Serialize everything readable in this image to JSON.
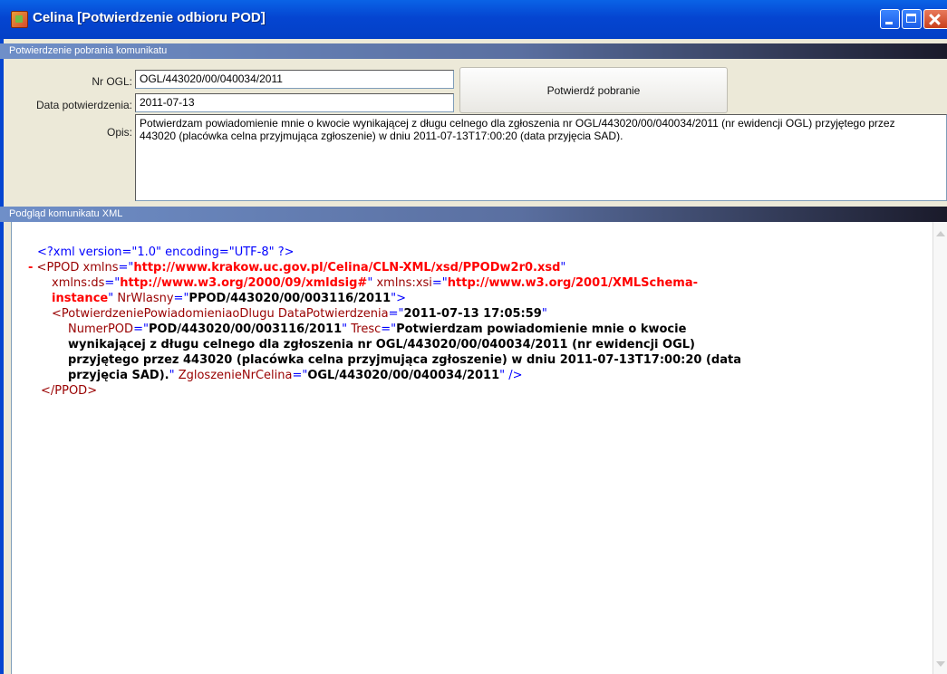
{
  "window": {
    "title": "Celina [Potwierdzenie odbioru POD]"
  },
  "confirm_section": {
    "header": "Potwierdzenie pobrania komunikatu",
    "nr_ogl_label": "Nr OGL:",
    "nr_ogl_value": "OGL/443020/00/040034/2011",
    "date_label": "Data potwierdzenia:",
    "date_value": "2011-07-13",
    "button_label": "Potwierdź pobranie",
    "opis_label": "Opis:",
    "opis_line1": "Potwierdzam powiadomienie mnie o kwocie wynikającej z długu celnego dla zgłoszenia nr OGL/443020/00/040034/2011 (nr ewidencji OGL) przyjętego przez",
    "opis_line2": "443020 (placówka celna przyjmująca zgłoszenie) w dniu 2011-07-13T17:00:20 (data przyjęcia SAD)."
  },
  "xml_section": {
    "header": "Podgląd komunikatu XML",
    "pi": "<?xml version=\"1.0\" encoding=\"UTF-8\" ?>",
    "minus": "-",
    "ppod_open": "<PPOD",
    "xmlns_attr": " xmlns",
    "xmlns_val": "http://www.krakow.uc.gov.pl/Celina/CLN-XML/xsd/PPODw2r0.xsd",
    "xmlns_ds_attr": "xmlns:ds",
    "xmlns_ds_val": "http://www.w3.org/2000/09/xmldsig#",
    "xmlns_xsi_attr": " xmlns:xsi",
    "xmlns_xsi_val1": "http://www.w3.org/2001/XMLSchema-",
    "xmlns_xsi_val2": "instance",
    "nrwlasny_attr": " NrWlasny",
    "nrwlasny_val": "PPOD/443020/00/003116/2011",
    "child_tag": "<PotwierdzeniePowiadomieniaoDlugu",
    "datapotw_attr": " DataPotwierdzenia",
    "datapotw_val": "2011-07-13 17:05:59",
    "numerpod_attr": "NumerPOD",
    "numerpod_val": "POD/443020/00/003116/2011",
    "tresc_attr": " Tresc",
    "tresc_val1": "Potwierdzam powiadomienie mnie o kwocie",
    "tresc_val2": "wynikającej z długu celnego dla zgłoszenia nr OGL/443020/00/040034/2011 (nr ewidencji OGL)",
    "tresc_val3": "przyjętego przez 443020 (placówka celna przyjmująca zgłoszenie) w dniu 2011-07-13T17:00:20 (data",
    "tresc_val4": "przyjęcia SAD).",
    "zgl_attr": " ZgloszenieNrCelina",
    "zgl_val": "OGL/443020/00/040034/2011",
    "self_close": " />",
    "ppod_close": "</PPOD>"
  }
}
